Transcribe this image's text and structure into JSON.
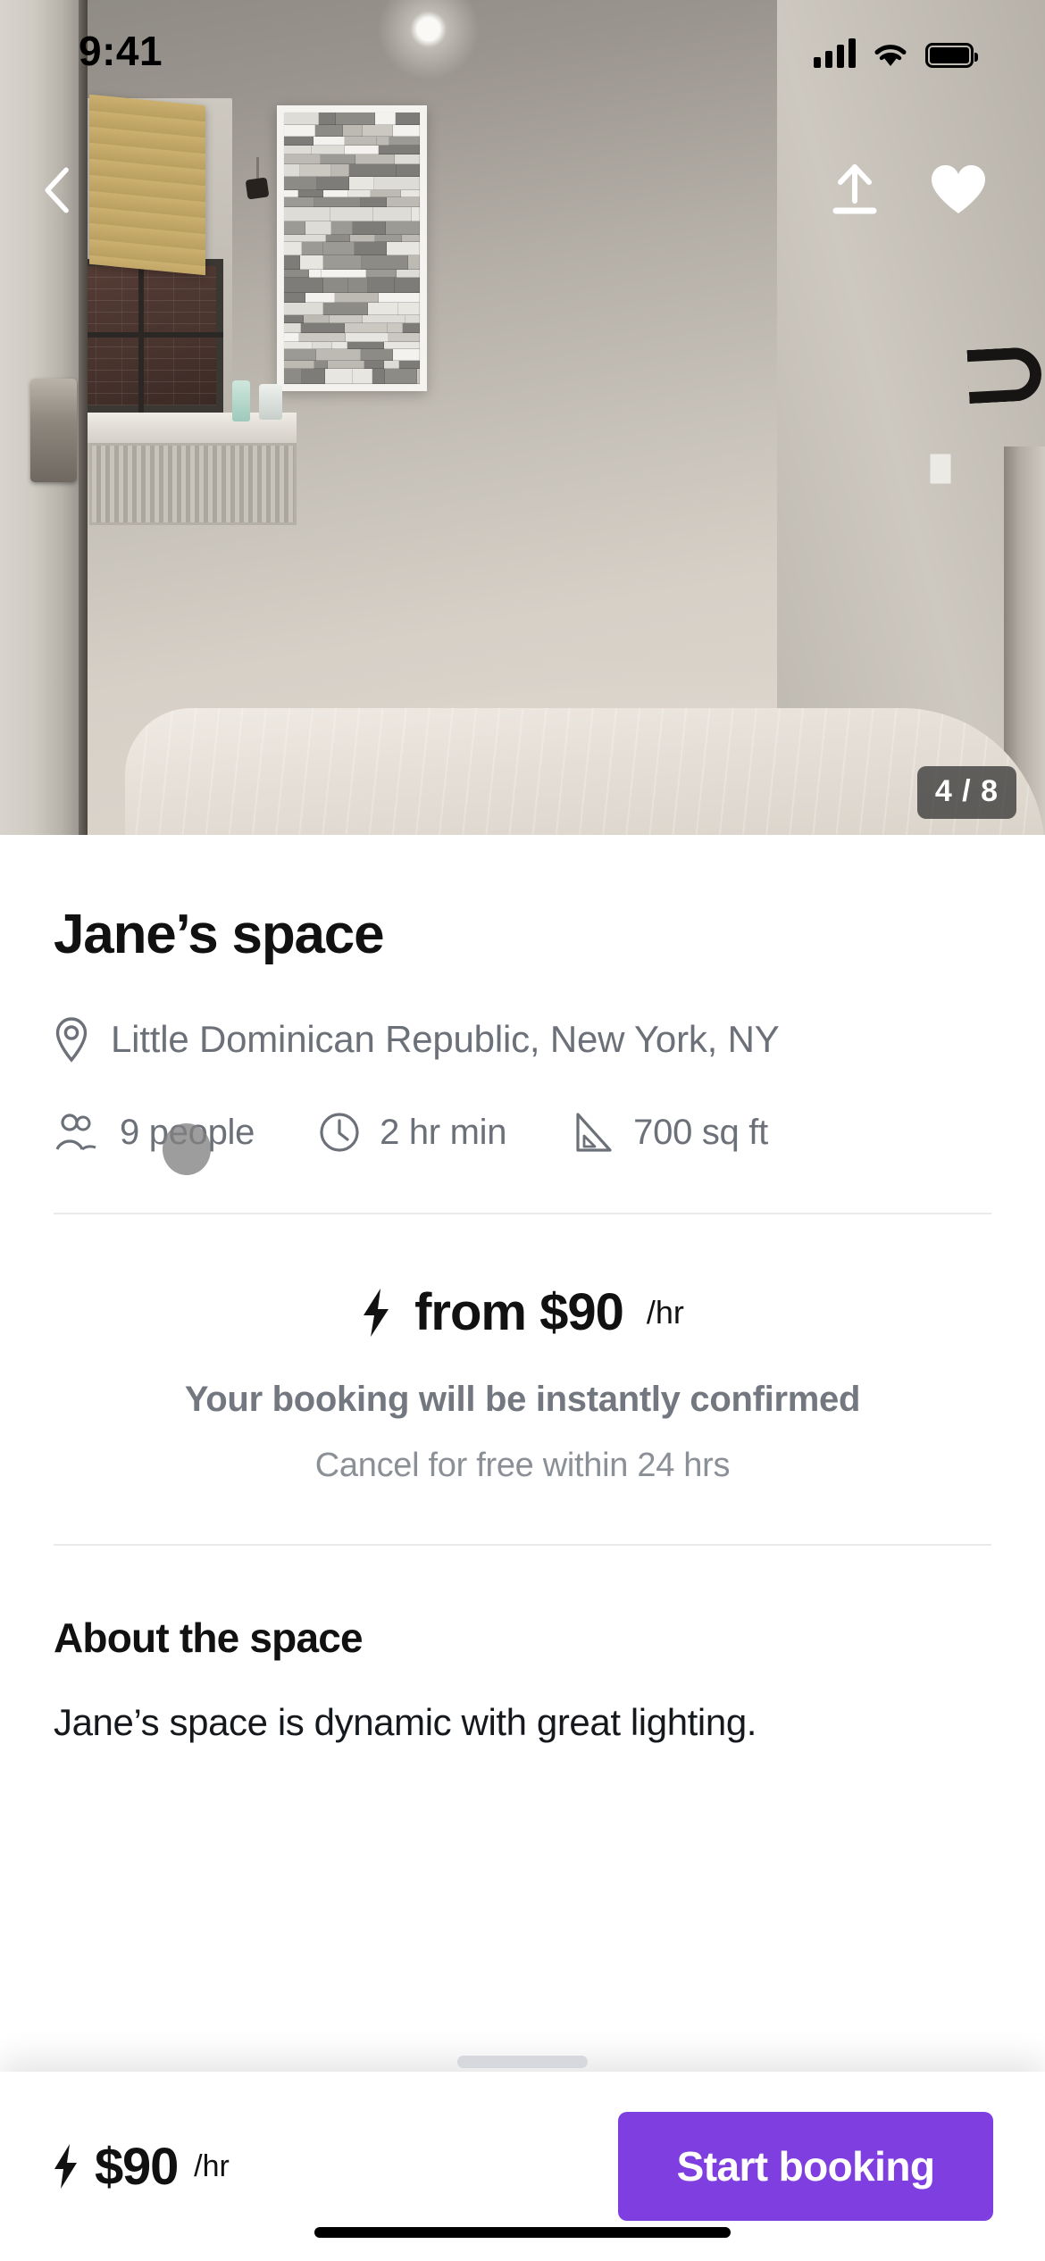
{
  "status_bar": {
    "time": "9:41",
    "signal_icon": "cellular-signal-icon",
    "wifi_icon": "wifi-icon",
    "battery_icon": "battery-icon"
  },
  "hero": {
    "back_icon": "chevron-left-icon",
    "share_icon": "share-upload-icon",
    "favorite_icon": "heart-filled-icon",
    "photo_counter": "4 / 8",
    "current_photo": 4,
    "total_photos": 8
  },
  "listing": {
    "title": "Jane’s space",
    "location_icon": "map-pin-icon",
    "location": "Little Dominican Republic, New York, NY",
    "specs": [
      {
        "icon": "people-icon",
        "label": "9 people"
      },
      {
        "icon": "clock-icon",
        "label": "2 hr min"
      },
      {
        "icon": "area-ruler-icon",
        "label": "700 sq ft"
      }
    ]
  },
  "pricing": {
    "bolt_icon": "lightning-bolt-icon",
    "from_label": "from $90",
    "unit": "/hr",
    "instant_note": "Your booking will be instantly confirmed",
    "cancel_note": "Cancel for free within 24 hrs"
  },
  "about": {
    "heading": "About the space",
    "description": "Jane’s space is dynamic with great lighting."
  },
  "bottom_bar": {
    "bolt_icon": "lightning-bolt-icon",
    "price": "$90",
    "unit": "/hr",
    "cta_label": "Start booking",
    "cta_color": "#7F3FE0",
    "grabber": "sheet-grabber-handle"
  },
  "colors": {
    "accent_purple": "#7F3FE0",
    "text_primary": "#111111",
    "text_secondary": "#6C7078",
    "text_tertiary": "#8B8F96",
    "divider": "#E9EAEC"
  }
}
